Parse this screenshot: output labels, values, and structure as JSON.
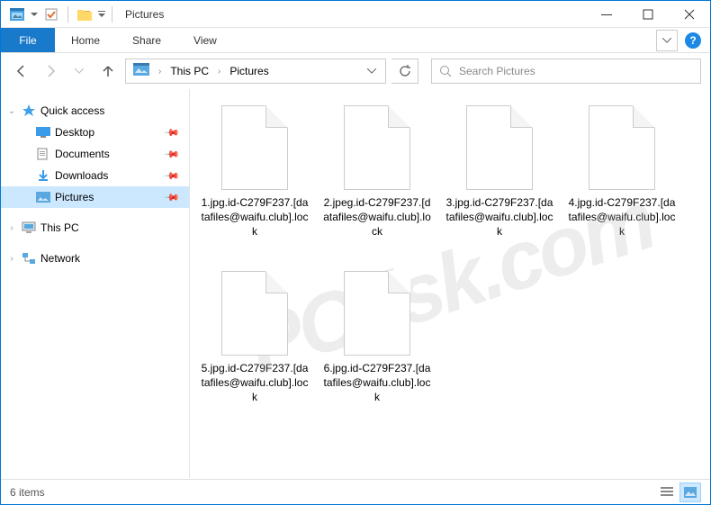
{
  "titlebar": {
    "title": "Pictures"
  },
  "ribbon": {
    "file": "File",
    "tabs": [
      "Home",
      "Share",
      "View"
    ]
  },
  "breadcrumb": {
    "segments": [
      "This PC",
      "Pictures"
    ]
  },
  "search": {
    "placeholder": "Search Pictures"
  },
  "sidebar": {
    "quick_access": "Quick access",
    "items": [
      {
        "label": "Desktop",
        "pinned": true
      },
      {
        "label": "Documents",
        "pinned": true
      },
      {
        "label": "Downloads",
        "pinned": true
      },
      {
        "label": "Pictures",
        "pinned": true,
        "selected": true
      }
    ],
    "this_pc": "This PC",
    "network": "Network"
  },
  "files": [
    {
      "name": "1.jpg.id-C279F237.[datafiles@waifu.club].lock"
    },
    {
      "name": "2.jpeg.id-C279F237.[datafiles@waifu.club].lock"
    },
    {
      "name": "3.jpg.id-C279F237.[datafiles@waifu.club].lock"
    },
    {
      "name": "4.jpg.id-C279F237.[datafiles@waifu.club].lock"
    },
    {
      "name": "5.jpg.id-C279F237.[datafiles@waifu.club].lock"
    },
    {
      "name": "6.jpg.id-C279F237.[datafiles@waifu.club].lock"
    }
  ],
  "statusbar": {
    "count": "6 items"
  },
  "watermark": "PCrisk.com"
}
